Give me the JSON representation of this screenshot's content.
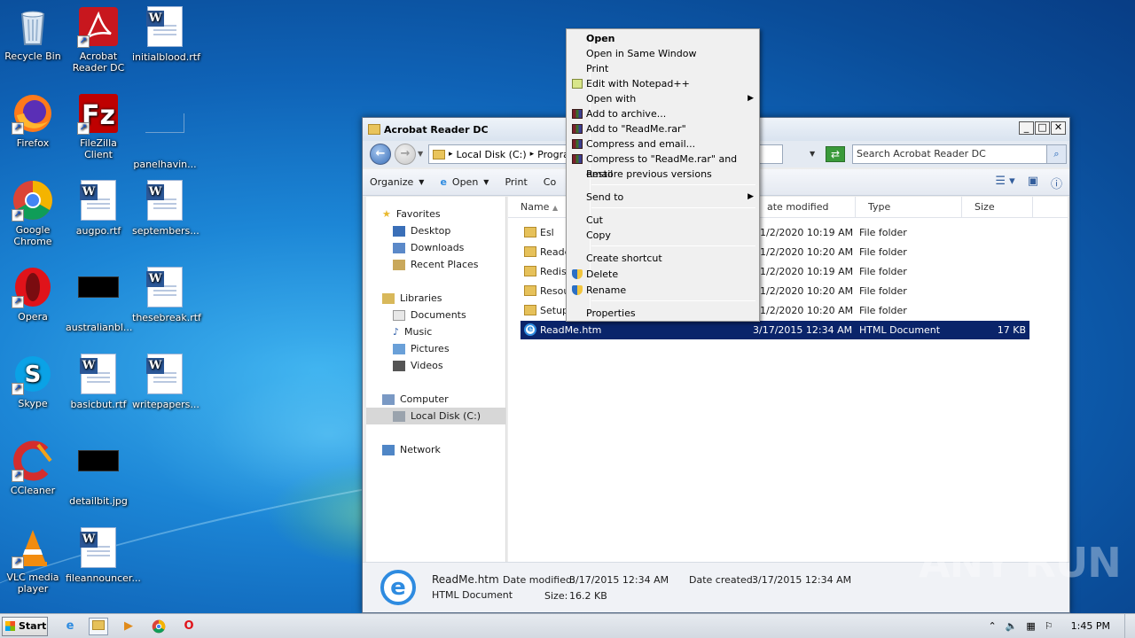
{
  "desktop": {
    "icons": [
      {
        "label": "Recycle Bin",
        "icon": "recycle-bin-icon"
      },
      {
        "label": "Acrobat Reader DC",
        "icon": "acrobat-icon"
      },
      {
        "label": "initialblood.rtf",
        "icon": "word-doc-icon"
      },
      {
        "label": "Firefox",
        "icon": "firefox-icon"
      },
      {
        "label": "FileZilla Client",
        "icon": "filezilla-icon"
      },
      {
        "label": "panelhavin...",
        "icon": "blank-file-icon"
      },
      {
        "label": "Google Chrome",
        "icon": "chrome-icon"
      },
      {
        "label": "augpo.rtf",
        "icon": "word-doc-icon"
      },
      {
        "label": "septembers...",
        "icon": "word-doc-icon"
      },
      {
        "label": "Opera",
        "icon": "opera-icon"
      },
      {
        "label": "australianbl...",
        "icon": "image-thumb-icon"
      },
      {
        "label": "thesebreak.rtf",
        "icon": "word-doc-icon"
      },
      {
        "label": "Skype",
        "icon": "skype-icon"
      },
      {
        "label": "basicbut.rtf",
        "icon": "word-doc-icon"
      },
      {
        "label": "writepapers...",
        "icon": "word-doc-icon"
      },
      {
        "label": "CCleaner",
        "icon": "ccleaner-icon"
      },
      {
        "label": "detailbit.jpg",
        "icon": "image-thumb-icon"
      },
      {
        "label": "VLC media player",
        "icon": "vlc-icon"
      },
      {
        "label": "fileannouncer...",
        "icon": "word-doc-icon"
      }
    ]
  },
  "window": {
    "title": "Acrobat Reader DC",
    "address": {
      "root": "Local Disk (C:)",
      "next": "Progra"
    },
    "search_placeholder": "Search Acrobat Reader DC",
    "toolbar": {
      "organize": "Organize",
      "open": "Open",
      "print": "Print",
      "more": "Co"
    },
    "nav": {
      "favorites": "Favorites",
      "desktop": "Desktop",
      "downloads": "Downloads",
      "recent": "Recent Places",
      "libraries": "Libraries",
      "documents": "Documents",
      "music": "Music",
      "pictures": "Pictures",
      "videos": "Videos",
      "computer": "Computer",
      "local_disk": "Local Disk (C:)",
      "network": "Network"
    },
    "columns": {
      "name": "Name",
      "date": "ate modified",
      "type": "Type",
      "size": "Size"
    },
    "files": [
      {
        "name": "Esl",
        "date": "1/2/2020 10:19 AM",
        "type": "File folder",
        "size": ""
      },
      {
        "name": "Reade",
        "date": "1/2/2020 10:20 AM",
        "type": "File folder",
        "size": ""
      },
      {
        "name": "Redist",
        "date": "1/2/2020 10:19 AM",
        "type": "File folder",
        "size": ""
      },
      {
        "name": "Resou",
        "date": "1/2/2020 10:20 AM",
        "type": "File folder",
        "size": ""
      },
      {
        "name": "Setup",
        "date": "1/2/2020 10:20 AM",
        "type": "File folder",
        "size": ""
      },
      {
        "name": "ReadMe.htm",
        "date": "3/17/2015 12:34 AM",
        "type": "HTML Document",
        "size": "17 KB"
      }
    ],
    "details": {
      "name": "ReadMe.htm",
      "type": "HTML Document",
      "modified_label": "Date modified:",
      "modified": "3/17/2015 12:34 AM",
      "created_label": "Date created:",
      "created": "3/17/2015 12:34 AM",
      "size_label": "Size:",
      "size": "16.2 KB"
    }
  },
  "context_menu": {
    "items": [
      {
        "label": "Open",
        "bold": true
      },
      {
        "label": "Open in Same Window"
      },
      {
        "label": "Print"
      },
      {
        "label": "Edit with Notepad++",
        "icon": "notepadpp-icon"
      },
      {
        "label": "Open with",
        "submenu": true
      },
      {
        "label": "Add to archive...",
        "icon": "winrar-icon"
      },
      {
        "label": "Add to \"ReadMe.rar\"",
        "icon": "winrar-icon"
      },
      {
        "label": "Compress and email...",
        "icon": "winrar-icon"
      },
      {
        "label": "Compress to \"ReadMe.rar\" and email",
        "icon": "winrar-icon"
      },
      {
        "label": "Restore previous versions"
      },
      {
        "label": "Send to",
        "submenu": true
      },
      {
        "label": "Cut"
      },
      {
        "label": "Copy"
      },
      {
        "label": "Create shortcut"
      },
      {
        "label": "Delete",
        "icon": "shield-icon"
      },
      {
        "label": "Rename",
        "icon": "shield-icon"
      },
      {
        "label": "Properties"
      }
    ]
  },
  "taskbar": {
    "start": "Start",
    "clock": "1:45 PM"
  },
  "watermark": "ANY RUN"
}
